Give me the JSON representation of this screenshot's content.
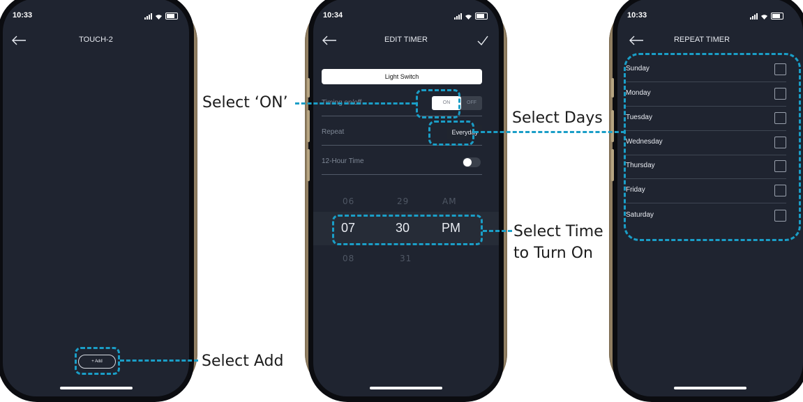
{
  "phone1": {
    "status_time": "10:33",
    "title": "TOUCH-2",
    "add_label": "+ Add"
  },
  "phone2": {
    "status_time": "10:34",
    "title": "EDIT TIMER",
    "device_field": "Light Switch",
    "timing_label": "Timing on/off",
    "on_label": "ON",
    "off_label": "OFF",
    "repeat_label": "Repeat",
    "repeat_value": "Everyday",
    "hour12_label": "12-Hour Time",
    "hour12_enabled": false,
    "picker": {
      "above": [
        "06",
        "29",
        "AM"
      ],
      "selected": [
        "07",
        "30",
        "PM"
      ],
      "below": [
        "08",
        "31"
      ]
    }
  },
  "phone3": {
    "status_time": "10:33",
    "title": "REPEAT TIMER",
    "days": [
      "Sunday",
      "Monday",
      "Tuesday",
      "Wednesday",
      "Thursday",
      "Friday",
      "Saturday"
    ]
  },
  "annotations": {
    "select_on": "Select ‘ON’",
    "select_days": "Select Days",
    "select_time_line1": "Select Time",
    "select_time_line2": "to Turn On",
    "select_add": "Select Add"
  },
  "colors": {
    "accent": "#1a9ec7",
    "screen": "#1f2430",
    "callout_text": "#1c1c1c"
  }
}
